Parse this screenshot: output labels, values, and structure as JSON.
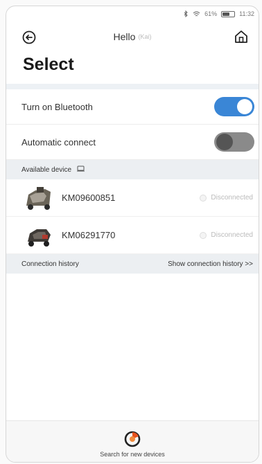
{
  "status_bar": {
    "battery": "61%",
    "time": "11:32"
  },
  "header": {
    "title": "Hello",
    "subtitle": "(Kai)"
  },
  "page": {
    "title": "Select"
  },
  "settings": [
    {
      "label": "Turn on Bluetooth",
      "enabled": true
    },
    {
      "label": "Automatic connect",
      "enabled": false
    }
  ],
  "available": {
    "label": "Available device"
  },
  "devices": [
    {
      "name": "KM09600851",
      "status": "Disconnected"
    },
    {
      "name": "KM06291770",
      "status": "Disconnected"
    }
  ],
  "history": {
    "label": "Connection history",
    "link": "Show connection history >>"
  },
  "footer": {
    "label": "Search for new devices"
  },
  "colors": {
    "toggle_on": "#3a86d6",
    "toggle_off": "#8a8a8a",
    "section_bg": "#eceff2"
  }
}
